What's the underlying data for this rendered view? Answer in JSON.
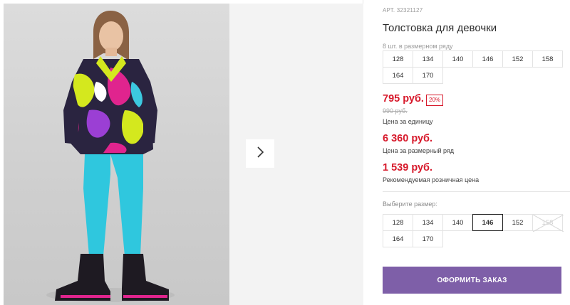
{
  "product": {
    "article": "АРТ. 32321127",
    "title": "Толстовка для девочки"
  },
  "pack": {
    "caption": "8 шт. в размерном ряду",
    "sizes": [
      "128",
      "134",
      "140",
      "146",
      "152",
      "158",
      "164",
      "170"
    ]
  },
  "pricing": {
    "price": "795 руб.",
    "discount": "20%",
    "old_price": "990 руб.",
    "unit_caption": "Цена за единицу",
    "pack_price": "6 360 руб.",
    "pack_caption": "Цена за размерный ряд",
    "retail_price": "1 539 руб.",
    "retail_caption": "Рекомендуемая розничная цена"
  },
  "size_picker": {
    "caption": "Выберите размер:",
    "sizes": [
      "128",
      "134",
      "140",
      "146",
      "152",
      "158",
      "164",
      "170"
    ],
    "selected": "146",
    "unavailable": [
      "158"
    ]
  },
  "actions": {
    "order_label": "ОФОРМИТЬ ЗАКАЗ"
  },
  "icons": {
    "next": "chevron-right-icon"
  },
  "colors": {
    "price_red": "#d7192b",
    "accent_purple": "#7e5fa8"
  }
}
